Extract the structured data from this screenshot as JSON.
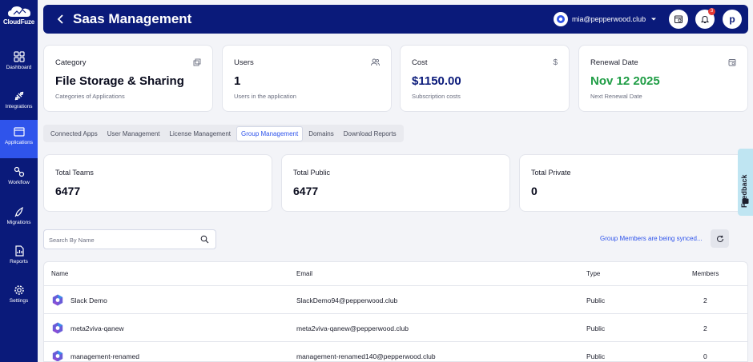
{
  "brand": {
    "name": "CloudFuze"
  },
  "sidebar": {
    "items": [
      {
        "label": "Dashboard",
        "icon": "grid-icon"
      },
      {
        "label": "Integrations",
        "icon": "plug-icon"
      },
      {
        "label": "Applications",
        "icon": "window-icon",
        "active": true
      },
      {
        "label": "Workflow",
        "icon": "workflow-icon"
      },
      {
        "label": "Migrations",
        "icon": "rocket-icon"
      },
      {
        "label": "Reports",
        "icon": "report-icon"
      },
      {
        "label": "Settings",
        "icon": "gear-icon"
      }
    ]
  },
  "header": {
    "title": "Saas Management",
    "account_email": "mia@pepperwood.club",
    "notification_count": "3",
    "avatar_letter": "p"
  },
  "summary_cards": [
    {
      "label": "Category",
      "value": "File Storage & Sharing",
      "sub": "Categories of Applications",
      "icon": "external-icon"
    },
    {
      "label": "Users",
      "value": "1",
      "sub": "Users in the application",
      "icon": "users-icon"
    },
    {
      "label": "Cost",
      "value": "$1150.00",
      "sub": "Subscription costs",
      "icon": "dollar-icon"
    },
    {
      "label": "Renewal Date",
      "value": "Nov 12 2025",
      "sub": "Next Renewal Date",
      "icon": "calendar-icon"
    }
  ],
  "tabs": [
    {
      "label": "Connected Apps"
    },
    {
      "label": "User Management"
    },
    {
      "label": "License Management"
    },
    {
      "label": "Group Management",
      "active": true
    },
    {
      "label": "Domains"
    },
    {
      "label": "Download Reports"
    }
  ],
  "stats": [
    {
      "label": "Total Teams",
      "value": "6477"
    },
    {
      "label": "Total Public",
      "value": "6477"
    },
    {
      "label": "Total Private",
      "value": "0"
    }
  ],
  "search": {
    "placeholder": "Search By Name"
  },
  "sync_status": "Group Members are being synced...",
  "table": {
    "columns": [
      "Name",
      "Email",
      "Type",
      "Members"
    ],
    "rows": [
      {
        "name": "Slack Demo",
        "email": "SlackDemo94@pepperwood.club",
        "type": "Public",
        "members": "2"
      },
      {
        "name": "meta2viva-qanew",
        "email": "meta2viva-qanew@pepperwood.club",
        "type": "Public",
        "members": "2"
      },
      {
        "name": "management-renamed",
        "email": "management-renamed140@pepperwood.club",
        "type": "Public",
        "members": "0"
      }
    ]
  },
  "feedback_label": "Feedback",
  "colors": {
    "navy": "#0a1a7a",
    "accent": "#2f54eb",
    "green": "#1f9d45"
  }
}
